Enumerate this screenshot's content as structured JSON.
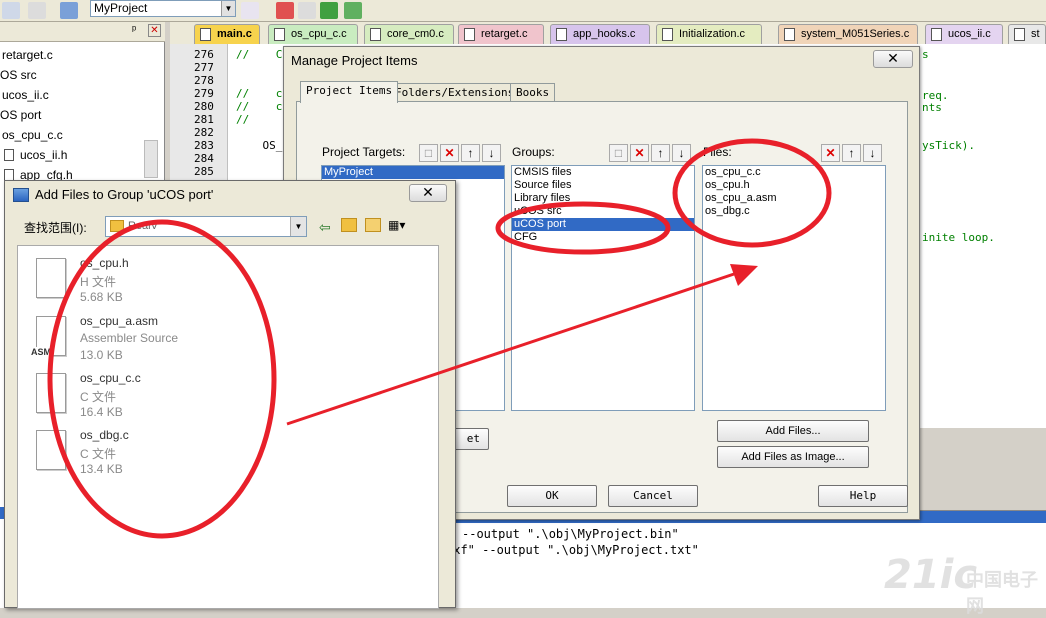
{
  "toolbar": {
    "project_name": "MyProject"
  },
  "editor_tabs": [
    "main.c",
    "os_cpu_c.c",
    "core_cm0.c",
    "retarget.c",
    "app_hooks.c",
    "Initialization.c",
    "system_M051Series.c",
    "ucos_ii.c",
    "st"
  ],
  "left_panel": {
    "items": [
      "retarget.c",
      "OS src",
      "ucos_ii.c",
      "OS port",
      "os_cpu_c.c",
      "ucos_ii.h",
      "app_cfg.h"
    ]
  },
  "editor": {
    "line_numbers": [
      "276",
      "277",
      "278",
      "279",
      "280",
      "281",
      "282",
      "283",
      "284",
      "285"
    ],
    "code_lines": [
      "//    C",
      "",
      "",
      "//    c",
      "//    c",
      "//",
      "",
      "    OS_",
      "",
      ""
    ],
    "right_fragments": [
      "s",
      "req.",
      "nts",
      "ysTick).",
      "inite loop."
    ]
  },
  "output": {
    "line1": "--output \".\\obj\\MyProject.bin\"",
    "line2": "axf\" --output \".\\obj\\MyProject.txt\""
  },
  "manage_dialog": {
    "title": "Manage Project Items",
    "close_glyph": "✕",
    "tabs": [
      "Project Items",
      "Folders/Extensions",
      "Books"
    ],
    "targets_label": "Project Targets:",
    "groups_label": "Groups:",
    "files_label": "Files:",
    "targets": [
      "MyProject"
    ],
    "groups": [
      "CMSIS files",
      "Source files",
      "Library files",
      "uCOS src",
      "uCOS port",
      "CFG"
    ],
    "selected_group": "uCOS port",
    "files": [
      "os_cpu_c.c",
      "os_cpu.h",
      "os_cpu_a.asm",
      "os_dbg.c"
    ],
    "add_files_label": "Add Files...",
    "add_image_label": "Add Files as Image...",
    "set_label": "et",
    "ok_label": "OK",
    "cancel_label": "Cancel",
    "help_label": "Help"
  },
  "add_dialog": {
    "title": "Add Files to Group 'uCOS port'",
    "close_glyph": "✕",
    "lookin_label": "查找范围(I):",
    "lookin_value": "RealV",
    "files": [
      {
        "name": "os_cpu.h",
        "type": "H 文件",
        "size": "5.68 KB"
      },
      {
        "name": "os_cpu_a.asm",
        "type": "Assembler Source",
        "size": "13.0 KB"
      },
      {
        "name": "os_cpu_c.c",
        "type": "C 文件",
        "size": "16.4 KB"
      },
      {
        "name": "os_dbg.c",
        "type": "C 文件",
        "size": "13.4 KB"
      }
    ]
  },
  "watermark": {
    "brand": "21ic",
    "cn": "中国电子网"
  },
  "colors": {
    "annotation_red": "#e8202a",
    "selection": "#316ac5"
  }
}
